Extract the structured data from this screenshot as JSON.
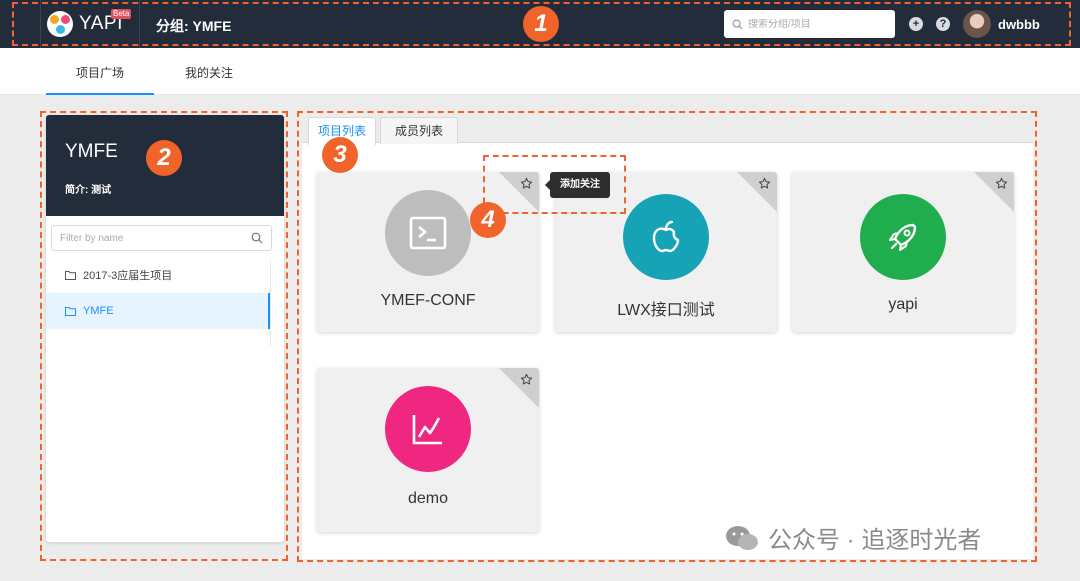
{
  "header": {
    "logo_text": "YAPI",
    "beta": "Beta",
    "group_title": "分组: YMFE",
    "search_placeholder": "搜索分组/项目",
    "add_icon": "+",
    "help_icon": "?",
    "username": "dwbbb"
  },
  "subnav": {
    "tabs": [
      {
        "label": "项目广场",
        "active": true
      },
      {
        "label": "我的关注",
        "active": false
      }
    ]
  },
  "sidebar": {
    "group_name": "YMFE",
    "description": "简介: 测试",
    "filter_placeholder": "Filter by name",
    "groups": [
      {
        "label": "2017-3应届生项目",
        "active": false
      },
      {
        "label": "YMFE",
        "active": true
      }
    ]
  },
  "main": {
    "tabs": [
      {
        "label": "项目列表",
        "active": true
      },
      {
        "label": "成员列表",
        "active": false
      }
    ],
    "projects": [
      {
        "name": "YMEF-CONF",
        "icon": "terminal-icon",
        "color": "#bdbdbd"
      },
      {
        "name": "LWX接口测试",
        "icon": "apple-icon",
        "color": "#16a3b6"
      },
      {
        "name": "yapi",
        "icon": "rocket-icon",
        "color": "#1fad4e"
      },
      {
        "name": "demo",
        "icon": "line-chart-icon",
        "color": "#f02781"
      }
    ],
    "tooltip": "添加关注"
  },
  "annotations": {
    "badges": [
      "1",
      "2",
      "3",
      "4"
    ],
    "color": "#f0642c"
  },
  "watermark": "公众号 · 追逐时光者"
}
